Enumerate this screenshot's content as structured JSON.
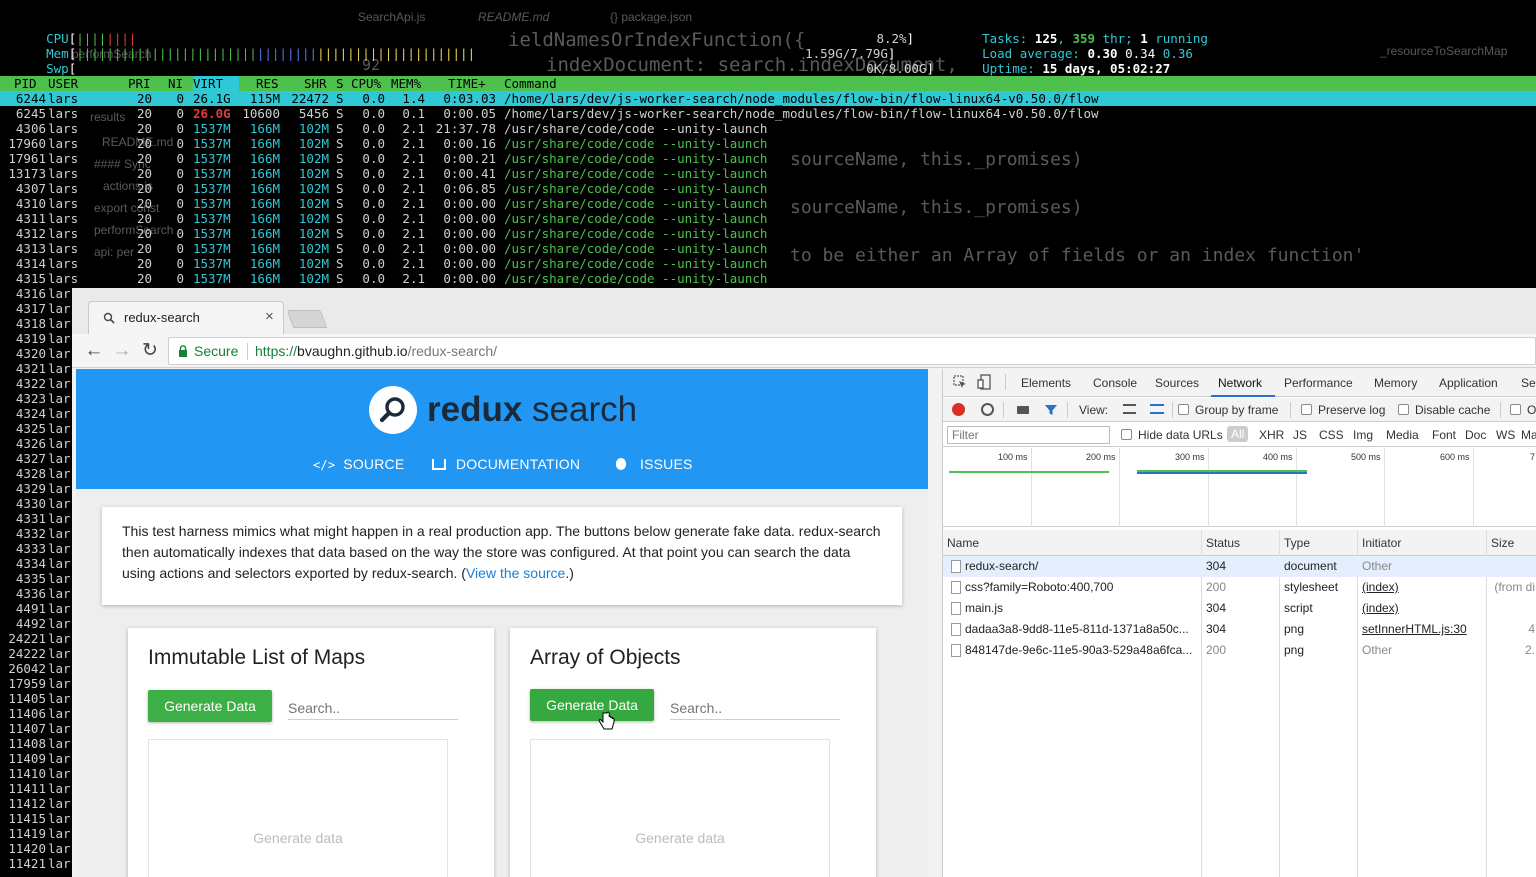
{
  "editor_bg": {
    "tabs": [
      "SearchApi.js",
      "README.md",
      "{} package.json"
    ],
    "search": "performSearch",
    "sidebar": [
      "results",
      "README.md",
      "#### Sync",
      "actions.js",
      "export const",
      "performSearch",
      "api: per"
    ],
    "code_lines": [
      "ieldNamesOrIndexFunction({",
      "indexDocument: search.indexDocument,"
    ],
    "code_ghosts": [
      "sourceName, this._promises)",
      "sourceName, this._promises)",
      "to be either an Array of fields or an index function'"
    ],
    "line_number": "92",
    "right_panel": "_resourceToSearchMap"
  },
  "htop": {
    "meters": [
      {
        "label": "CPU",
        "value": "8.2%"
      },
      {
        "label": "Mem",
        "value": "1.59G/7.79G"
      },
      {
        "label": "Swp",
        "value": "0K/8.00G"
      }
    ],
    "tasks_label": "Tasks:",
    "tasks": "125",
    "threads": "359",
    "thr_label": "thr;",
    "running": "1",
    "running_label": "running",
    "load_label": "Load average:",
    "load1": "0.30",
    "load5": "0.34",
    "load15": "0.36",
    "uptime_label": "Uptime:",
    "uptime": "15 days, 05:02:27",
    "columns": [
      "PID",
      "USER",
      "PRI",
      "NI",
      "VIRT",
      "RES",
      "SHR",
      "S",
      "CPU%",
      "MEM%",
      "TIME+",
      "Command"
    ],
    "processes": [
      {
        "pid": "6244",
        "user": "lars",
        "pri": "20",
        "ni": "0",
        "virt": "26.1G",
        "res": "115M",
        "shr": "22472",
        "s": "S",
        "cpu": "0.0",
        "mem": "1.4",
        "time": "0:03.03",
        "cmd": "/home/lars/dev/js-worker-search/node_modules/flow-bin/flow-linux64-v0.50.0/flow"
      },
      {
        "pid": "6245",
        "user": "lars",
        "pri": "20",
        "ni": "0",
        "virt": "26.0G",
        "res": "10600",
        "shr": "5456",
        "s": "S",
        "cpu": "0.0",
        "mem": "0.1",
        "time": "0:00.05",
        "cmd": "/home/lars/dev/js-worker-search/node_modules/flow-bin/flow-linux64-v0.50.0/flow"
      },
      {
        "pid": "4306",
        "user": "lars",
        "pri": "20",
        "ni": "0",
        "virt": "1537M",
        "res": "166M",
        "shr": "102M",
        "s": "S",
        "cpu": "0.0",
        "mem": "2.1",
        "time": "21:37.78",
        "cmd": "/usr/share/code/code --unity-launch"
      },
      {
        "pid": "17960",
        "user": "lars",
        "pri": "20",
        "ni": "0",
        "virt": "1537M",
        "res": "166M",
        "shr": "102M",
        "s": "S",
        "cpu": "0.0",
        "mem": "2.1",
        "time": "0:00.16",
        "cmd": "/usr/share/code/code --unity-launch"
      },
      {
        "pid": "17961",
        "user": "lars",
        "pri": "20",
        "ni": "0",
        "virt": "1537M",
        "res": "166M",
        "shr": "102M",
        "s": "S",
        "cpu": "0.0",
        "mem": "2.1",
        "time": "0:00.21",
        "cmd": "/usr/share/code/code --unity-launch"
      },
      {
        "pid": "13173",
        "user": "lars",
        "pri": "20",
        "ni": "0",
        "virt": "1537M",
        "res": "166M",
        "shr": "102M",
        "s": "S",
        "cpu": "0.0",
        "mem": "2.1",
        "time": "0:00.41",
        "cmd": "/usr/share/code/code --unity-launch"
      },
      {
        "pid": "4307",
        "user": "lars",
        "pri": "20",
        "ni": "0",
        "virt": "1537M",
        "res": "166M",
        "shr": "102M",
        "s": "S",
        "cpu": "0.0",
        "mem": "2.1",
        "time": "0:06.85",
        "cmd": "/usr/share/code/code --unity-launch"
      },
      {
        "pid": "4310",
        "user": "lars",
        "pri": "20",
        "ni": "0",
        "virt": "1537M",
        "res": "166M",
        "shr": "102M",
        "s": "S",
        "cpu": "0.0",
        "mem": "2.1",
        "time": "0:00.00",
        "cmd": "/usr/share/code/code --unity-launch"
      },
      {
        "pid": "4311",
        "user": "lars",
        "pri": "20",
        "ni": "0",
        "virt": "1537M",
        "res": "166M",
        "shr": "102M",
        "s": "S",
        "cpu": "0.0",
        "mem": "2.1",
        "time": "0:00.00",
        "cmd": "/usr/share/code/code --unity-launch"
      },
      {
        "pid": "4312",
        "user": "lars",
        "pri": "20",
        "ni": "0",
        "virt": "1537M",
        "res": "166M",
        "shr": "102M",
        "s": "S",
        "cpu": "0.0",
        "mem": "2.1",
        "time": "0:00.00",
        "cmd": "/usr/share/code/code --unity-launch"
      },
      {
        "pid": "4313",
        "user": "lars",
        "pri": "20",
        "ni": "0",
        "virt": "1537M",
        "res": "166M",
        "shr": "102M",
        "s": "S",
        "cpu": "0.0",
        "mem": "2.1",
        "time": "0:00.00",
        "cmd": "/usr/share/code/code --unity-launch"
      },
      {
        "pid": "4314",
        "user": "lars",
        "pri": "20",
        "ni": "0",
        "virt": "1537M",
        "res": "166M",
        "shr": "102M",
        "s": "S",
        "cpu": "0.0",
        "mem": "2.1",
        "time": "0:00.00",
        "cmd": "/usr/share/code/code --unity-launch"
      },
      {
        "pid": "4315",
        "user": "lars",
        "pri": "20",
        "ni": "0",
        "virt": "1537M",
        "res": "166M",
        "shr": "102M",
        "s": "S",
        "cpu": "0.0",
        "mem": "2.1",
        "time": "0:00.00",
        "cmd": "/usr/share/code/code --unity-launch"
      }
    ],
    "hidden_pids": [
      "4316",
      "4317",
      "4318",
      "4319",
      "4320",
      "4321",
      "4322",
      "4323",
      "4324",
      "4325",
      "4326",
      "4327",
      "4328",
      "4329",
      "4330",
      "4331",
      "4332",
      "4333",
      "4334",
      "4335",
      "4336",
      "4491",
      "4492",
      "24221",
      "24222",
      "26042",
      "17959",
      "11405",
      "11406",
      "11407",
      "11408",
      "11409",
      "11410",
      "11411",
      "11412",
      "11415",
      "11419",
      "11420",
      "11421"
    ],
    "hidden_user": "lar"
  },
  "browser": {
    "tab_title": "redux-search",
    "secure_label": "Secure",
    "url_scheme": "https://",
    "url_host": "bvaughn.github.io",
    "url_path": "/redux-search/"
  },
  "page": {
    "brand_bold": "redux",
    "brand_light": "search",
    "nav": [
      "SOURCE",
      "DOCUMENTATION",
      "ISSUES"
    ],
    "intro_text": "This test harness mimics what might happen in a real production app. The buttons below generate fake data. redux-search then automatically indexes that data based on the way the store was configured. At that point you can search the data using actions and selectors exported by redux-search. (",
    "intro_link": "View the source",
    "intro_end": ".)",
    "cards": [
      {
        "title": "Immutable List of Maps",
        "button": "Generate Data",
        "placeholder": "Search..",
        "empty": "Generate data"
      },
      {
        "title": "Array of Objects",
        "button": "Generate Data",
        "placeholder": "Search..",
        "empty": "Generate data"
      }
    ]
  },
  "devtools": {
    "tabs": [
      "Elements",
      "Console",
      "Sources",
      "Network",
      "Performance",
      "Memory",
      "Application",
      "Se"
    ],
    "active_tab": "Network",
    "view_label": "View:",
    "group_by_frame": "Group by frame",
    "preserve_log": "Preserve log",
    "disable_cache": "Disable cache",
    "offline": "O",
    "filter_placeholder": "Filter",
    "hide_data_urls": "Hide data URLs",
    "type_filters": [
      "All",
      "XHR",
      "JS",
      "CSS",
      "Img",
      "Media",
      "Font",
      "Doc",
      "WS",
      "Man"
    ],
    "timeline_ticks": [
      "100 ms",
      "200 ms",
      "300 ms",
      "400 ms",
      "500 ms",
      "600 ms",
      "7"
    ],
    "columns": [
      "Name",
      "Status",
      "Type",
      "Initiator",
      "Size"
    ],
    "requests": [
      {
        "name": "redux-search/",
        "status": "304",
        "type": "document",
        "initiator": "Other",
        "size": ""
      },
      {
        "name": "css?family=Roboto:400,700",
        "status": "200",
        "type": "stylesheet",
        "initiator": "(index)",
        "size": "(from di"
      },
      {
        "name": "main.js",
        "status": "304",
        "type": "script",
        "initiator": "(index)",
        "size": ""
      },
      {
        "name": "dadaa3a8-9dd8-11e5-811d-1371a8a50c...",
        "status": "304",
        "type": "png",
        "initiator": "setInnerHTML.js:30",
        "size": "4"
      },
      {
        "name": "848147de-9e6c-11e5-90a3-529a48a6fca...",
        "status": "200",
        "type": "png",
        "initiator": "Other",
        "size": "2."
      }
    ]
  },
  "colors": {
    "htop_green": "#4ec04e",
    "htop_cyan": "#2fc9d6",
    "hero_blue": "#2196f3",
    "button_green": "#3cb046",
    "link_blue": "#1a7fd4",
    "secure_green": "#188038"
  }
}
